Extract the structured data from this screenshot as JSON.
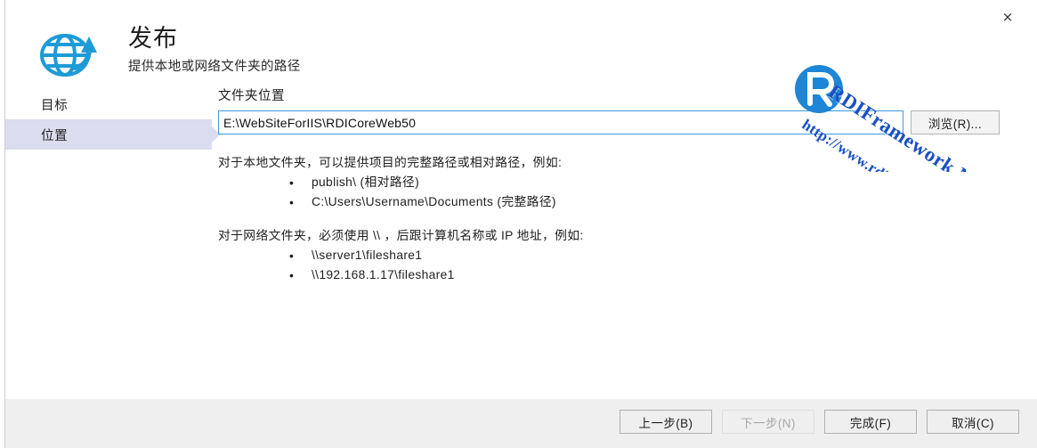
{
  "dialog": {
    "title": "发布",
    "subtitle": "提供本地或网络文件夹的路径",
    "close_label": "×",
    "publish_icon": "globe-upload-icon"
  },
  "sidebar": {
    "items": [
      {
        "label": "目标",
        "selected": false
      },
      {
        "label": "位置",
        "selected": true
      }
    ]
  },
  "main": {
    "folder_label": "文件夹位置",
    "path_value": "E:\\WebSiteForIIS\\RDICoreWeb50",
    "path_placeholder": "",
    "browse_label": "浏览(R)...",
    "help": {
      "local_intro": "对于本地文件夹，可以提供项目的完整路径或相对路径，例如:",
      "local_items": [
        "publish\\ (相对路径)",
        "C:\\Users\\Username\\Documents (完整路径)"
      ],
      "network_intro": "对于网络文件夹，必须使用 \\\\ ，后跟计算机名称或 IP 地址，例如:",
      "network_items": [
        "\\\\server1\\fileshare1",
        "\\\\192.168.1.17\\fileshare1"
      ]
    }
  },
  "watermark": {
    "name": "RDIFramework.NET",
    "url": "http://www.rdiframework.net",
    "color": "#1b4fc4"
  },
  "footer": {
    "buttons": [
      {
        "label": "上一步(B)",
        "disabled": false
      },
      {
        "label": "下一步(N)",
        "disabled": true
      },
      {
        "label": "完成(F)",
        "disabled": false
      },
      {
        "label": "取消(C)",
        "disabled": false
      }
    ]
  },
  "colors": {
    "accent": "#3b9add",
    "selection": "#dcdcf0",
    "footer_bg": "#efefef"
  }
}
